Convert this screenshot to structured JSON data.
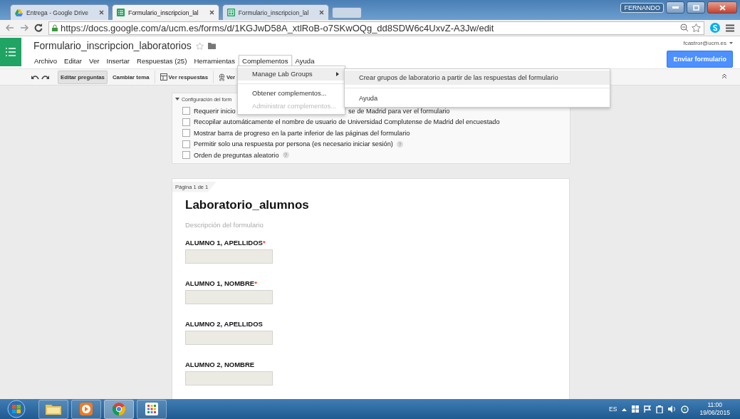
{
  "browser": {
    "tabs": [
      {
        "title": "Entrega - Google Drive",
        "kind": "drive",
        "selected": false
      },
      {
        "title": "Formulario_inscripcion_lal",
        "kind": "forms",
        "selected": true
      },
      {
        "title": "Formulario_inscripcion_lal",
        "kind": "sheet",
        "selected": false
      }
    ],
    "user": "FERNANDO",
    "url": "https://docs.google.com/a/ucm.es/forms/d/1KGJwD58A_xtlRoB-o7SKwOQg_dd8SDW6c4UxvZ-A3Jw/edit"
  },
  "docs": {
    "title": "Formulario_inscripcion_laboratorios",
    "menu": [
      {
        "label": "Archivo",
        "open": false
      },
      {
        "label": "Editar",
        "open": false
      },
      {
        "label": "Ver",
        "open": false
      },
      {
        "label": "Insertar",
        "open": false
      },
      {
        "label": "Respuestas (25)",
        "open": false
      },
      {
        "label": "Herramientas",
        "open": false
      },
      {
        "label": "Complementos",
        "open": true
      },
      {
        "label": "Ayuda",
        "open": false
      }
    ],
    "account": "fcastror@ucm.es",
    "send_button": "Enviar formulario"
  },
  "toolbar": [
    {
      "label": "Editar preguntas",
      "kind": "text",
      "selected": true
    },
    {
      "label": "Cambiar tema",
      "kind": "text",
      "selected": false
    },
    {
      "label": "Ver respuestas",
      "kind": "table",
      "selected": false
    },
    {
      "label": "Ver",
      "kind": "globe",
      "selected": false
    }
  ],
  "settings": {
    "header": "Configuración del form",
    "options": [
      {
        "label": "Requerir inicio",
        "label_end": "se de Madrid para ver el formulario",
        "checked": false
      },
      {
        "label": "Recopilar automáticamente el nombre de usuario de Universidad Complutense de Madrid del encuestado",
        "checked": false
      },
      {
        "label": "Mostrar barra de progreso en la parte inferior de las páginas del formulario",
        "checked": false
      },
      {
        "label": "Permitir solo una respuesta por persona (es necesario iniciar sesión)",
        "help": "?",
        "checked": false
      },
      {
        "label": "Orden de preguntas aleatorio",
        "help": "?",
        "checked": false
      }
    ]
  },
  "addons_menu": {
    "items": [
      {
        "label": "Manage Lab Groups",
        "kind": "submenu",
        "selected": true,
        "disabled": false,
        "separator_before": false
      },
      {
        "label": "Obtener complementos...",
        "kind": "item",
        "selected": false,
        "disabled": false,
        "separator_before": true
      },
      {
        "label": "Administrar complementos...",
        "kind": "item",
        "selected": false,
        "disabled": true,
        "separator_before": false
      }
    ],
    "submenu": [
      {
        "label": "Crear grupos de laboratorio a partir de las respuestas del formulario",
        "selected": true,
        "separator_before": false
      },
      {
        "label": "Ayuda",
        "selected": false,
        "separator_before": true
      }
    ]
  },
  "form": {
    "page_label": "Página 1 de 1",
    "title": "Laboratorio_alumnos",
    "description": {
      "placeholder": "Descripción del formulario"
    },
    "questions": [
      {
        "label": "ALUMNO 1, APELLIDOS",
        "required_mark": "*"
      },
      {
        "label": "ALUMNO 1, NOMBRE",
        "required_mark": "*"
      },
      {
        "label": "ALUMNO 2, APELLIDOS"
      },
      {
        "label": "ALUMNO 2, NOMBRE"
      }
    ]
  },
  "taskbar": {
    "apps": [
      {
        "kind": "folder",
        "active": false
      },
      {
        "kind": "media",
        "active": false
      },
      {
        "kind": "chrome",
        "active": true
      },
      {
        "kind": "apps",
        "active": false
      }
    ],
    "language": "ES",
    "time": "11:00",
    "date": "19/06/2015"
  }
}
